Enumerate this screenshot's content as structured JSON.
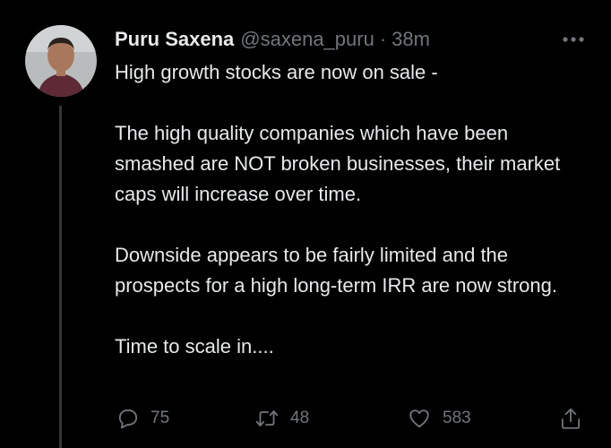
{
  "tweet": {
    "author_name": "Puru Saxena",
    "handle": "@saxena_puru",
    "separator": "·",
    "time": "38m",
    "paragraphs": [
      "High growth stocks are now on sale -",
      "The high quality companies which have been smashed are NOT broken businesses, their market caps will increase over time.",
      "Downside appears to be fairly limited and the prospects for a high long-term IRR are now strong.",
      "Time to scale in...."
    ]
  },
  "actions": {
    "reply_count": "75",
    "retweet_count": "48",
    "like_count": "583"
  },
  "icons": {
    "more": "more-horizontal-icon",
    "reply": "reply-icon",
    "retweet": "retweet-icon",
    "like": "heart-icon",
    "share": "share-icon"
  },
  "colors": {
    "background": "#000000",
    "primary_text": "#e7e9ea",
    "secondary_text": "#71767b",
    "thread_line": "#333639"
  }
}
